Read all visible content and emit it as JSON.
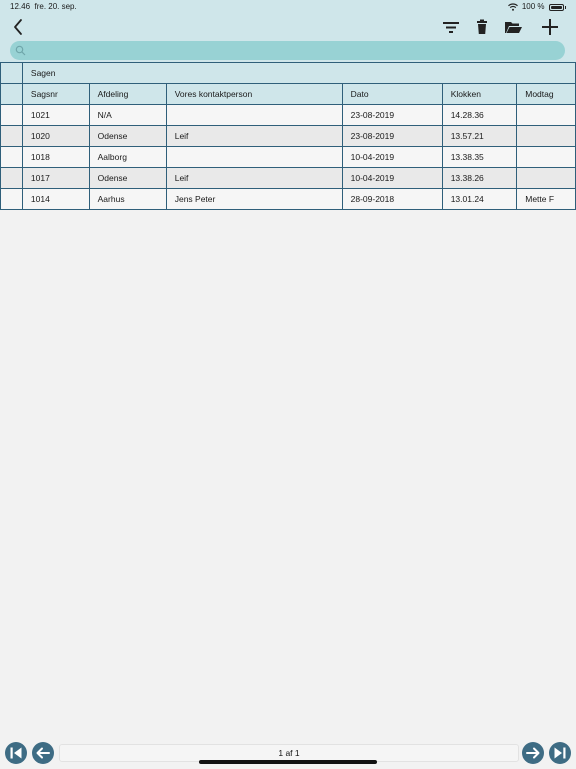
{
  "status": {
    "time": "12.46",
    "date": "fre. 20. sep.",
    "battery": "100 %"
  },
  "icons": {
    "back": "chevron-left-icon",
    "filter": "filter-icon",
    "delete": "trash-icon",
    "open": "folder-open-icon",
    "add": "plus-icon",
    "search": "search-icon",
    "first": "first-page-icon",
    "prev": "arrow-left-icon",
    "next": "arrow-right-icon",
    "last": "last-page-icon"
  },
  "colors": {
    "header_bg": "#cfe6ea",
    "search_bg": "#98d2d4",
    "grid_line": "#2f5f7a",
    "nav_button": "#3e6c84"
  },
  "search": {
    "placeholder": "",
    "value": ""
  },
  "table": {
    "group_label": "Sagen",
    "columns": [
      "Sagsnr",
      "Afdeling",
      "Vores kontaktperson",
      "Dato",
      "Klokken",
      "Modtag"
    ],
    "rows": [
      [
        "1021",
        "N/A",
        "",
        "23-08-2019",
        "14.28.36",
        ""
      ],
      [
        "1020",
        "Odense",
        "Leif",
        "23-08-2019",
        "13.57.21",
        ""
      ],
      [
        "1018",
        "Aalborg",
        "",
        "10-04-2019",
        "13.38.35",
        ""
      ],
      [
        "1017",
        "Odense",
        "Leif",
        "10-04-2019",
        "13.38.26",
        ""
      ],
      [
        "1014",
        "Aarhus",
        "Jens Peter",
        "28-09-2018",
        "13.01.24",
        "Mette F"
      ]
    ]
  },
  "pager": {
    "label": "1 af 1"
  }
}
